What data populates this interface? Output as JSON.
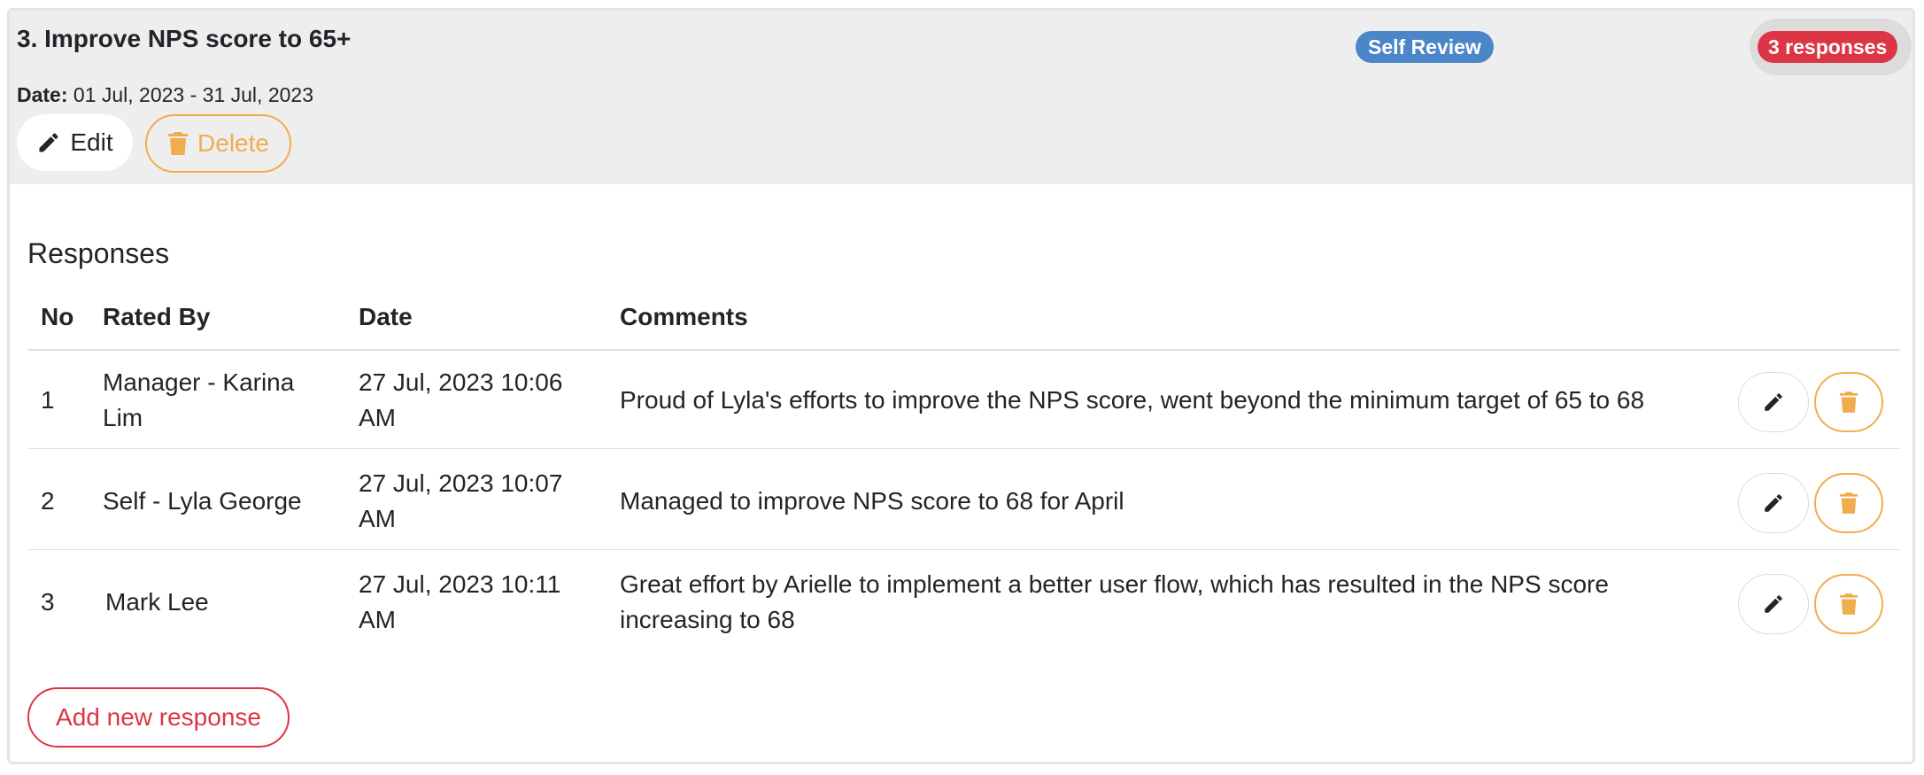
{
  "goal": {
    "title": "3. Improve NPS score to 65+",
    "review_badge": "Self Review",
    "responses_badge": "3 responses",
    "date_label": "Date:",
    "date_value": "01 Jul, 2023 - 31 Jul, 2023",
    "edit_label": "Edit",
    "delete_label": "Delete"
  },
  "responses": {
    "section_title": "Responses",
    "columns": [
      "No",
      "Rated By",
      "Date",
      "Comments"
    ],
    "rows": [
      {
        "no": "1",
        "rated_by": "Manager - Karina Lim",
        "date": "27 Jul, 2023 10:06 AM",
        "comment": "Proud of Lyla's efforts to improve the NPS score, went beyond the minimum target of 65 to 68"
      },
      {
        "no": "2",
        "rated_by": "Self - Lyla George",
        "date": "27 Jul, 2023 10:07 AM",
        "comment": "Managed to improve NPS score to 68 for April"
      },
      {
        "no": "3",
        "rated_by": "Mark Lee",
        "date": "27 Jul, 2023 10:11 AM",
        "comment": "Great effort by Arielle to implement a better user flow, which has resulted in the NPS score increasing to 68"
      }
    ],
    "add_label": "Add new response"
  },
  "icons": {
    "edit": "pencil-icon",
    "delete": "trash-icon"
  },
  "colors": {
    "review_badge": "#4a86c8",
    "responses_badge": "#dc3545",
    "delete_accent": "#f0ad4e",
    "add_accent": "#dc3545",
    "header_bg": "#eeeeee"
  }
}
